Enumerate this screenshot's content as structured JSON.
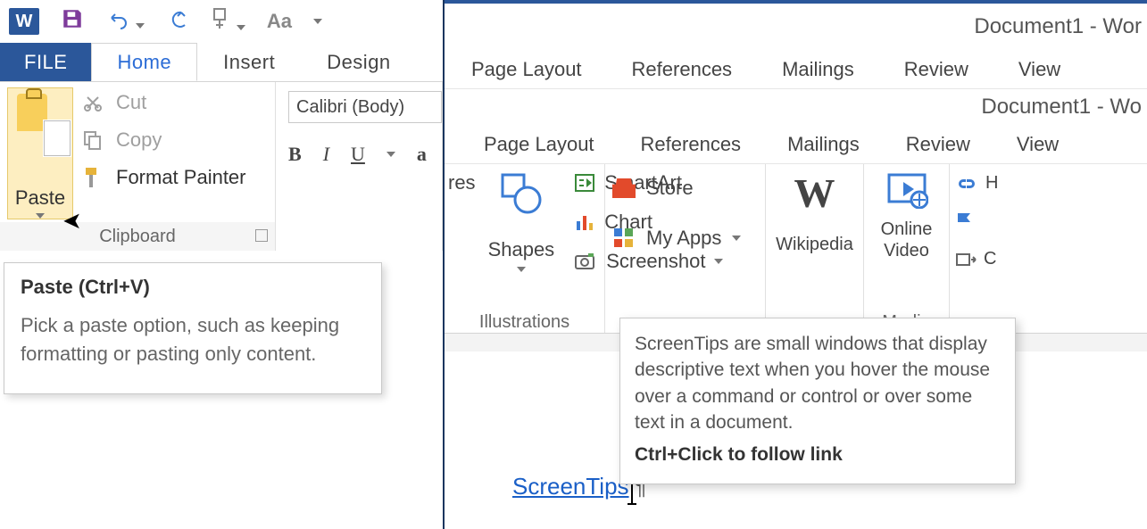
{
  "app": {
    "title_left": "Document1 - Wor",
    "title_right_1": "Document1 - Wor",
    "title_right_2": "Document1 - Wo"
  },
  "qat": {
    "logo_letter": "W",
    "aa": "Aa"
  },
  "tabs1": {
    "file": "FILE",
    "home": "Home",
    "insert": "Insert",
    "design": "Design"
  },
  "paste": {
    "label": "Paste",
    "tooltip_title": "Paste (Ctrl+V)",
    "tooltip_body": "Pick a paste option, such as keeping formatting or pasting only content."
  },
  "clipboard": {
    "cut": "Cut",
    "copy": "Copy",
    "format_painter": "Format Painter",
    "group_label": "Clipboard"
  },
  "font": {
    "name": "Calibri (Body)",
    "b": "B",
    "i": "I",
    "u": "U",
    "a": "a"
  },
  "tabs_top": {
    "page_layout": "Page Layout",
    "references": "References",
    "mailings": "Mailings",
    "review": "Review",
    "view": "View"
  },
  "tabs_mid": {
    "page_layout": "Page Layout",
    "references": "References",
    "mailings": "Mailings",
    "review": "Review",
    "view": "View"
  },
  "ribbon2": {
    "res": "res",
    "shapes": "Shapes",
    "smartart": "SmartArt",
    "chart": "Chart",
    "screenshot": "Screenshot",
    "illustrations": "Illustrations",
    "store": "Store",
    "myapps": "My Apps",
    "wikipedia": "Wikipedia",
    "online_video": "Online\nVideo",
    "media": "Media",
    "link_h": "H",
    "link_c": "C"
  },
  "doc": {
    "link_text": "ScreenTips",
    "pilcrow": "¶"
  },
  "screentip2": {
    "body": "ScreenTips are small windows that display descriptive text when you hover the mouse over a command or control or over some text in a document.",
    "ctrl": "Ctrl+Click to follow link"
  }
}
